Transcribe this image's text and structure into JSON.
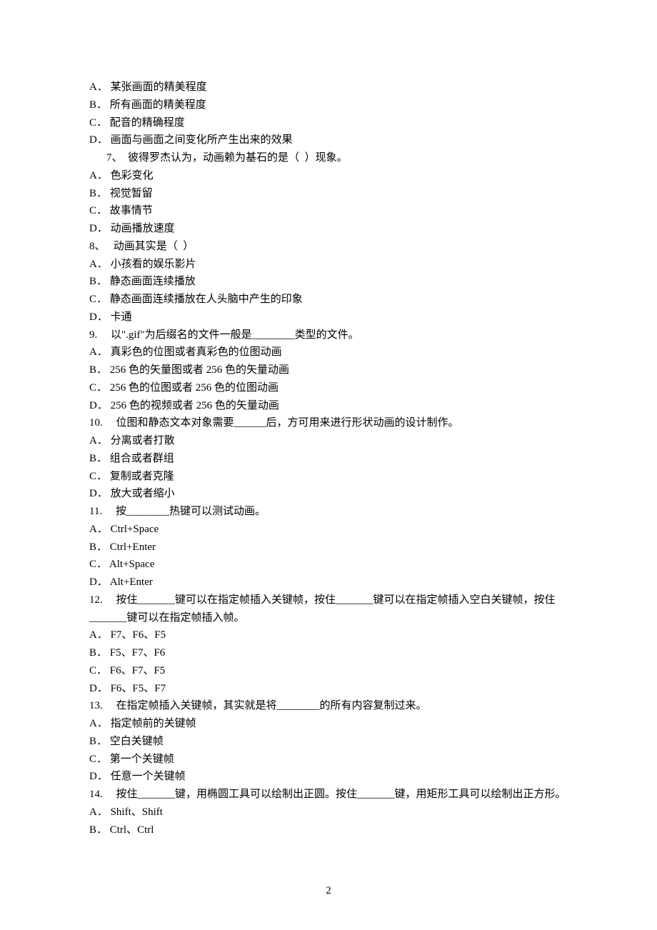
{
  "lines": [
    {
      "text": "A． 某张画面的精美程度",
      "indent": false
    },
    {
      "text": "B． 所有画面的精美程度",
      "indent": false
    },
    {
      "text": "C． 配音的精确程度",
      "indent": false
    },
    {
      "text": "D． 画面与画面之间变化所产生出来的效果",
      "indent": false
    },
    {
      "text": "7、　彼得罗杰认为，动画赖为基石的是（  ）现象。",
      "indent": true
    },
    {
      "text": "A． 色彩变化",
      "indent": false
    },
    {
      "text": "B． 视觉暂留",
      "indent": false
    },
    {
      "text": "C． 故事情节",
      "indent": false
    },
    {
      "text": "D． 动画播放速度",
      "indent": false
    },
    {
      "text": "8、　 动画其实是（  ）",
      "indent": false
    },
    {
      "text": "A． 小孩看的娱乐影片",
      "indent": false
    },
    {
      "text": "B． 静态画面连续播放",
      "indent": false
    },
    {
      "text": "C． 静态画面连续播放在人头脑中产生的印象",
      "indent": false
    },
    {
      "text": "D． 卡通",
      "indent": false
    },
    {
      "text": "9.　 以\".gif\"为后缀名的文件一般是________类型的文件。",
      "indent": false
    },
    {
      "text": "A． 真彩色的位图或者真彩色的位图动画",
      "indent": false
    },
    {
      "text": "B． 256 色的矢量图或者 256 色的矢量动画",
      "indent": false
    },
    {
      "text": "C． 256 色的位图或者 256 色的位图动画",
      "indent": false
    },
    {
      "text": "D． 256 色的视频或者 256 色的矢量动画",
      "indent": false
    },
    {
      "text": "10.　 位图和静态文本对象需要______后，方可用来进行形状动画的设计制作。",
      "indent": false
    },
    {
      "text": "A． 分离或者打散",
      "indent": false
    },
    {
      "text": "B． 组合或者群组",
      "indent": false
    },
    {
      "text": "C． 复制或者克隆",
      "indent": false
    },
    {
      "text": "D． 放大或者缩小",
      "indent": false
    },
    {
      "text": "11.　 按________热键可以测试动画。",
      "indent": false
    },
    {
      "text": "A． Ctrl+Space",
      "indent": false
    },
    {
      "text": "B． Ctrl+Enter",
      "indent": false
    },
    {
      "text": "C． Alt+Space",
      "indent": false
    },
    {
      "text": "D． Alt+Enter",
      "indent": false
    },
    {
      "text": "12.　 按住_______键可以在指定帧插入关键帧，按住_______键可以在指定帧插入空白关键帧，按住_______键可以在指定帧插入帧。",
      "indent": false
    },
    {
      "text": "A． F7、F6、F5",
      "indent": false
    },
    {
      "text": "B． F5、F7、F6",
      "indent": false
    },
    {
      "text": "C． F6、F7、F5",
      "indent": false
    },
    {
      "text": "D． F6、F5、F7",
      "indent": false
    },
    {
      "text": "13.　 在指定帧插入关键帧，其实就是将________的所有内容复制过来。",
      "indent": false
    },
    {
      "text": "A． 指定帧前的关键帧",
      "indent": false
    },
    {
      "text": "B． 空白关键帧",
      "indent": false
    },
    {
      "text": "C． 第一个关键帧",
      "indent": false
    },
    {
      "text": "D． 任意一个关键帧",
      "indent": false
    },
    {
      "text": "14.　 按住_______键，用椭圆工具可以绘制出正圆。按住_______键，用矩形工具可以绘制出正方形。",
      "indent": false
    },
    {
      "text": "A． Shift、Shift",
      "indent": false
    },
    {
      "text": "B． Ctrl、Ctrl",
      "indent": false
    }
  ],
  "pageNumber": "2"
}
